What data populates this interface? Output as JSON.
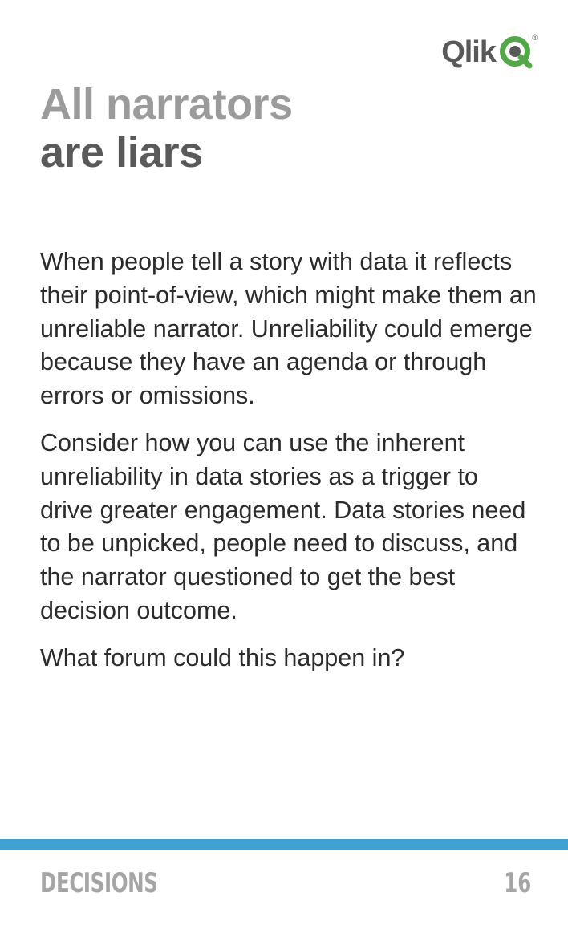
{
  "logo": {
    "text": "Qlik",
    "mark": "qlik-q-icon",
    "registered": "®",
    "brand_color": "#52a849"
  },
  "title": {
    "line1": "All narrators",
    "line2": "are liars"
  },
  "body": {
    "paragraphs": [
      "When people tell a story with data it reflects their point-of-view, which might make them an unreliable narrator. Unreliability could emerge because they have an agenda or through errors or omissions.",
      "Consider how you can use the inherent unreliability in data stories as a trigger to drive greater engagement. Data stories need to be unpicked, people need to discuss, and the narrator questioned to get the best decision outcome.",
      "What forum could this happen in?"
    ]
  },
  "footer": {
    "section": "DECISIONS",
    "page": "16",
    "bar_color": "#3fa2d1"
  }
}
